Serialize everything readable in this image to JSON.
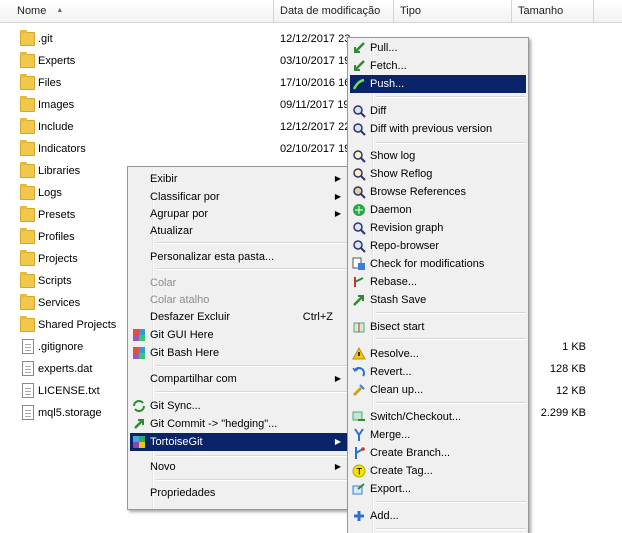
{
  "columns": {
    "name": "Nome",
    "date": "Data de modificação",
    "type": "Tipo",
    "size": "Tamanho"
  },
  "files": [
    {
      "name": ".git",
      "date": "12/12/2017 23",
      "kind": "folder"
    },
    {
      "name": "Experts",
      "date": "03/10/2017 19",
      "kind": "folder"
    },
    {
      "name": "Files",
      "date": "17/10/2016 16",
      "kind": "folder"
    },
    {
      "name": "Images",
      "date": "09/11/2017 19",
      "kind": "folder"
    },
    {
      "name": "Include",
      "date": "12/12/2017 22",
      "kind": "folder"
    },
    {
      "name": "Indicators",
      "date": "02/10/2017 19",
      "kind": "folder"
    },
    {
      "name": "Libraries",
      "date": "",
      "kind": "folder"
    },
    {
      "name": "Logs",
      "date": "",
      "kind": "folder"
    },
    {
      "name": "Presets",
      "date": "",
      "kind": "folder"
    },
    {
      "name": "Profiles",
      "date": "",
      "kind": "folder"
    },
    {
      "name": "Projects",
      "date": "",
      "kind": "folder"
    },
    {
      "name": "Scripts",
      "date": "",
      "kind": "folder"
    },
    {
      "name": "Services",
      "date": "",
      "kind": "folder"
    },
    {
      "name": "Shared Projects",
      "date": "",
      "kind": "folder"
    },
    {
      "name": ".gitignore",
      "date": "",
      "kind": "file",
      "size": "1 KB"
    },
    {
      "name": "experts.dat",
      "date": "",
      "kind": "file",
      "size": "128 KB"
    },
    {
      "name": "LICENSE.txt",
      "date": "",
      "kind": "file",
      "size": "12 KB"
    },
    {
      "name": "mql5.storage",
      "date": "",
      "kind": "file",
      "size": "2.299 KB"
    }
  ],
  "context_menu": {
    "exibir": "Exibir",
    "classificar": "Classificar por",
    "agrupar": "Agrupar por",
    "atualizar": "Atualizar",
    "personalizar": "Personalizar esta pasta...",
    "colar": "Colar",
    "colar_atalho": "Colar atalho",
    "desfazer": "Desfazer Excluir",
    "desfazer_shortcut": "Ctrl+Z",
    "git_gui": "Git GUI Here",
    "git_bash": "Git Bash Here",
    "compartilhar": "Compartilhar com",
    "git_sync": "Git Sync...",
    "git_commit": "Git Commit -> \"hedging\"...",
    "tortoisegit": "TortoiseGit",
    "novo": "Novo",
    "propriedades": "Propriedades"
  },
  "tortoise_menu": {
    "pull": "Pull...",
    "fetch": "Fetch...",
    "push": "Push...",
    "diff": "Diff",
    "diff_prev": "Diff with previous version",
    "show_log": "Show log",
    "show_reflog": "Show Reflog",
    "browse_refs": "Browse References",
    "daemon": "Daemon",
    "revision_graph": "Revision graph",
    "repo_browser": "Repo-browser",
    "check_mods": "Check for modifications",
    "rebase": "Rebase...",
    "stash_save": "Stash Save",
    "bisect_start": "Bisect start",
    "resolve": "Resolve...",
    "revert": "Revert...",
    "clean_up": "Clean up...",
    "switch": "Switch/Checkout...",
    "merge": "Merge...",
    "create_branch": "Create Branch...",
    "create_tag": "Create Tag...",
    "export": "Export...",
    "add": "Add..."
  }
}
